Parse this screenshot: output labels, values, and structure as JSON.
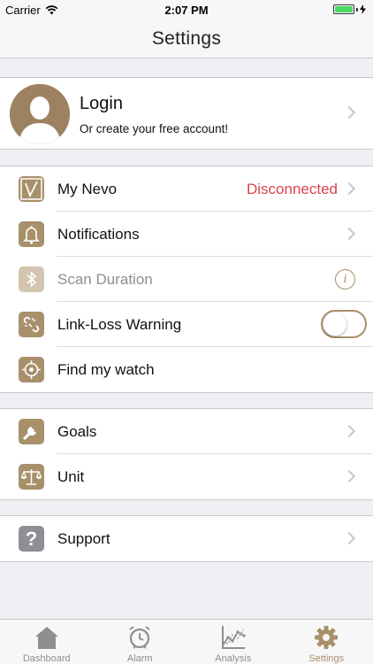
{
  "status_bar": {
    "carrier": "Carrier",
    "time": "2:07 PM"
  },
  "nav": {
    "title": "Settings"
  },
  "login": {
    "title": "Login",
    "subtitle": "Or create your free account!"
  },
  "device_group": {
    "my_nevo": {
      "label": "My Nevo",
      "value": "Disconnected",
      "icon": "nevo-logo-icon"
    },
    "notifications": {
      "label": "Notifications",
      "icon": "bell-icon"
    },
    "scan_duration": {
      "label": "Scan Duration",
      "icon": "bluetooth-icon",
      "info_glyph": "i"
    },
    "link_loss": {
      "label": "Link-Loss Warning",
      "icon": "broken-link-icon",
      "toggle_on": false
    },
    "find_watch": {
      "label": "Find my watch",
      "icon": "crosshair-icon"
    }
  },
  "prefs_group": {
    "goals": {
      "label": "Goals",
      "icon": "wrench-icon"
    },
    "unit": {
      "label": "Unit",
      "icon": "scale-icon"
    }
  },
  "support_group": {
    "support": {
      "label": "Support",
      "icon": "question-icon",
      "glyph": "?"
    }
  },
  "tabs": [
    {
      "label": "Dashboard",
      "icon": "home-icon",
      "active": false
    },
    {
      "label": "Alarm",
      "icon": "alarm-clock-icon",
      "active": false
    },
    {
      "label": "Analysis",
      "icon": "chart-icon",
      "active": false
    },
    {
      "label": "Settings",
      "icon": "gear-icon",
      "active": true
    }
  ],
  "colors": {
    "accent": "#a8906a",
    "disconnected": "#d9434b",
    "inactive_tab": "#8e8e93",
    "battery": "#4cd964"
  }
}
